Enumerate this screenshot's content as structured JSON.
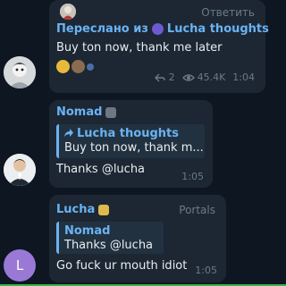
{
  "messages": [
    {
      "reply_label": "Ответить",
      "forward_prefix": "Переслано из",
      "forward_source": "Lucha thoughts",
      "text": "Buy ton now, thank me later",
      "replies": "2",
      "views": "45.4K",
      "time": "1:04"
    },
    {
      "sender": "Nomad",
      "quote_author": "Lucha thoughts",
      "quote_text": "Buy ton now, thank m...",
      "text": "Thanks @lucha",
      "time": "1:05"
    },
    {
      "sender": "Lucha",
      "admin_title": "Portals",
      "quote_author": "Nomad",
      "quote_text": "Thanks @lucha",
      "text": "Go fuck ur mouth idiot",
      "time": "1:05",
      "avatar_letter": "L"
    }
  ],
  "colors": {
    "background": "#0e1621",
    "bubble": "#1c2733",
    "accent": "#6ab3f3",
    "muted": "#6b7a88",
    "avatar_letter_bg": "#9a79d6"
  }
}
